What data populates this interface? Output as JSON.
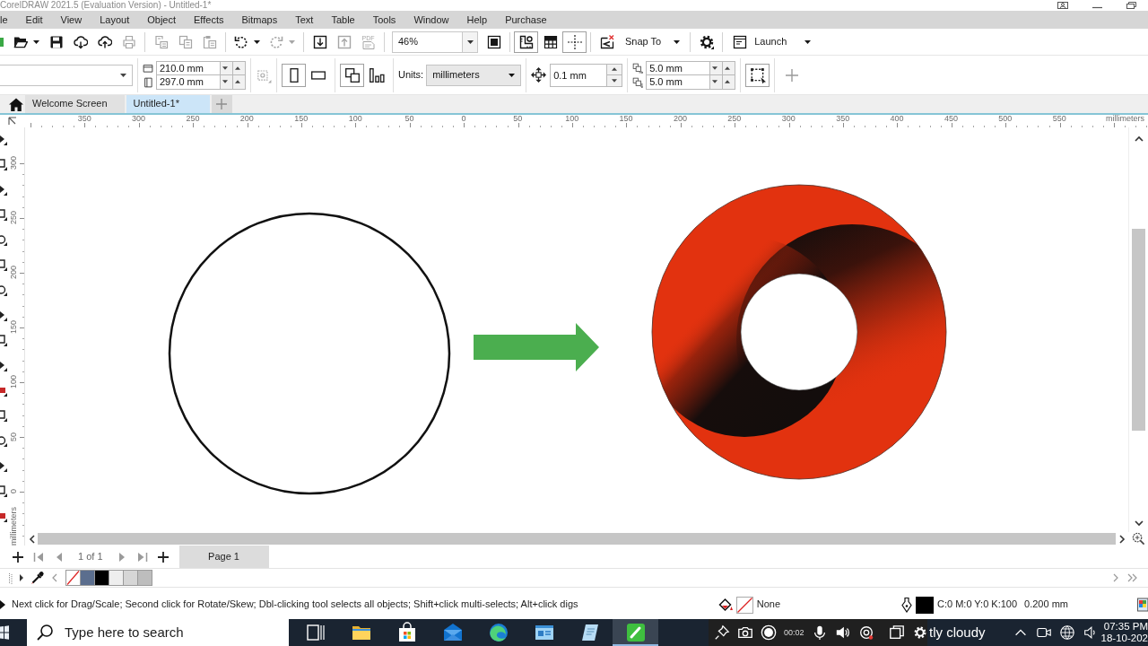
{
  "window": {
    "title": "CorelDRAW 2021.5 (Evaluation Version) - Untitled-1*"
  },
  "menu": [
    "le",
    "Edit",
    "View",
    "Layout",
    "Object",
    "Effects",
    "Bitmaps",
    "Text",
    "Table",
    "Tools",
    "Window",
    "Help",
    "Purchase"
  ],
  "toolbar": {
    "groups": [
      {
        "buttons": [
          {
            "kind": "open",
            "disabled": false,
            "on": false,
            "dropdown": true
          },
          {
            "kind": "save",
            "disabled": false,
            "on": false,
            "dropdown": false
          },
          {
            "kind": "cloud-download",
            "disabled": false,
            "on": false,
            "dropdown": false
          },
          {
            "kind": "cloud-upload",
            "disabled": false,
            "on": false,
            "dropdown": false
          },
          {
            "kind": "print",
            "disabled": true,
            "on": false,
            "dropdown": false
          }
        ]
      },
      {
        "buttons": [
          {
            "kind": "copy-properties",
            "disabled": true,
            "on": false,
            "dropdown": false
          },
          {
            "kind": "copy",
            "disabled": true,
            "on": false,
            "dropdown": false
          },
          {
            "kind": "paste",
            "disabled": true,
            "on": false,
            "dropdown": false
          }
        ]
      },
      {
        "buttons": [
          {
            "kind": "undo",
            "disabled": false,
            "on": false,
            "dropdown": true
          },
          {
            "kind": "redo",
            "disabled": true,
            "on": false,
            "dropdown": true
          }
        ]
      },
      {
        "buttons": [
          {
            "kind": "import",
            "disabled": false,
            "on": false,
            "dropdown": false
          },
          {
            "kind": "export",
            "disabled": true,
            "on": false,
            "dropdown": false
          },
          {
            "kind": "pdf",
            "label": "PDF",
            "disabled": true,
            "on": false,
            "dropdown": false
          }
        ]
      },
      {
        "buttons": [
          {
            "kind": "zoom",
            "value": "46%",
            "disabled": false,
            "on": false,
            "dropdown": true
          },
          {
            "kind": "full-screen",
            "disabled": false,
            "on": false,
            "dropdown": false
          }
        ]
      },
      {
        "buttons": [
          {
            "kind": "rulers",
            "disabled": false,
            "on": true,
            "dropdown": false
          },
          {
            "kind": "grid",
            "disabled": false,
            "on": false,
            "dropdown": false
          },
          {
            "kind": "guidelines",
            "disabled": false,
            "on": true,
            "dropdown": false
          }
        ]
      },
      {
        "buttons": [
          {
            "kind": "snap-off",
            "disabled": false,
            "on": false,
            "dropdown": false
          },
          {
            "kind": "snap-menu",
            "label": "Snap To",
            "disabled": false,
            "on": false,
            "dropdown": true
          }
        ]
      },
      {
        "buttons": [
          {
            "kind": "options",
            "disabled": false,
            "on": false,
            "dropdown": false
          }
        ]
      },
      {
        "buttons": [
          {
            "kind": "launch",
            "label": "Launch",
            "disabled": false,
            "on": false,
            "dropdown": true
          }
        ]
      }
    ]
  },
  "property_bar": {
    "page_width": "210.0 mm",
    "page_height": "297.0 mm",
    "orientation": [
      {
        "kind": "portrait",
        "selected": true
      },
      {
        "kind": "landscape",
        "selected": false
      }
    ],
    "page_scope": [
      {
        "kind": "all-pages",
        "selected": true
      },
      {
        "kind": "current-page",
        "selected": false
      }
    ],
    "units_label": "Units:",
    "units": "millimeters",
    "nudge": "0.1 mm",
    "duplicate_x": "5.0 mm",
    "duplicate_y": "5.0 mm",
    "marquee_toggle": {
      "on": true
    }
  },
  "document_tabs": [
    {
      "label": "Welcome Screen",
      "selected": false
    },
    {
      "label": "Untitled-1*",
      "selected": true
    }
  ],
  "horizontal_ruler": {
    "labels": [
      "350",
      "300",
      "250",
      "200",
      "150",
      "100",
      "50",
      "0",
      "50",
      "100",
      "150",
      "200",
      "250",
      "300",
      "350",
      "400",
      "450",
      "500",
      "550"
    ],
    "unit": "millimeters"
  },
  "vertical_ruler": {
    "labels": [
      "300",
      "250",
      "200",
      "150",
      "100",
      "50",
      "0"
    ],
    "unit": "millimeters"
  },
  "page_navigation": {
    "before_counter": [
      {
        "kind": "add",
        "disabled": false
      },
      {
        "kind": "first",
        "disabled": true
      },
      {
        "kind": "previous",
        "disabled": true
      }
    ],
    "counter": "1 of 1",
    "after_counter": [
      {
        "kind": "next",
        "disabled": true
      },
      {
        "kind": "last",
        "disabled": true
      },
      {
        "kind": "add",
        "disabled": false
      }
    ],
    "pages": [
      {
        "label": "Page 1",
        "selected": true
      }
    ]
  },
  "palette": {
    "swatches": [
      {
        "kind": "none"
      },
      {
        "kind": "color",
        "color": "#5b6e8e"
      },
      {
        "kind": "color",
        "color": "#000000"
      },
      {
        "kind": "color",
        "color": "#eeeeee"
      },
      {
        "kind": "color",
        "color": "#d6d6d6"
      },
      {
        "kind": "color",
        "color": "#bdbdbd"
      }
    ]
  },
  "status_bar": {
    "hint": "Next click for Drag/Scale; Second click for Rotate/Skew; Dbl-clicking tool selects all objects; Shift+click multi-selects; Alt+click digs",
    "fill": "None",
    "outline_color": "C:0 M:0 Y:0 K:100",
    "outline_width": "0.200 mm"
  },
  "taskbar": {
    "search_placeholder": "Type here to search",
    "apps": [
      {
        "kind": "task-view",
        "active": false
      },
      {
        "kind": "file-explorer",
        "active": false
      },
      {
        "kind": "store",
        "active": false
      },
      {
        "kind": "mail",
        "active": false
      },
      {
        "kind": "browser",
        "active": false
      },
      {
        "kind": "app-window",
        "active": false
      },
      {
        "kind": "notepad",
        "active": false
      },
      {
        "kind": "draw-app",
        "active": true
      }
    ],
    "recording_time": "00:02",
    "weather": "tly cloudy",
    "time": "07:35 PM",
    "date": "18-10-202"
  }
}
